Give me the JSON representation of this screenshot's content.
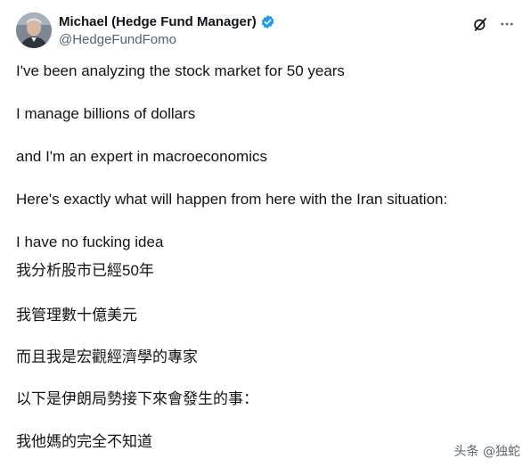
{
  "author": {
    "display_name": "Michael (Hedge Fund Manager)",
    "handle": "@HedgeFundFomo",
    "verified": true,
    "verified_color": "#1d9bf0"
  },
  "icons": {
    "verified": "verified-badge-icon",
    "grok": "grok-slash-icon",
    "more": "more-horizontal-icon"
  },
  "tweet": {
    "lines": [
      "I've been analyzing the stock market for 50 years",
      "I manage billions of dollars",
      "and I'm an expert in macroeconomics",
      "Here's exactly what will happen from here with the Iran situation:",
      "I have no fucking idea",
      "我分析股市已經50年",
      "我管理數十億美元",
      "而且我是宏觀經濟學的專家",
      "以下是伊朗局勢接下來會發生的事：",
      "我他媽的完全不知道"
    ]
  },
  "watermark": "头条 @独蛇"
}
